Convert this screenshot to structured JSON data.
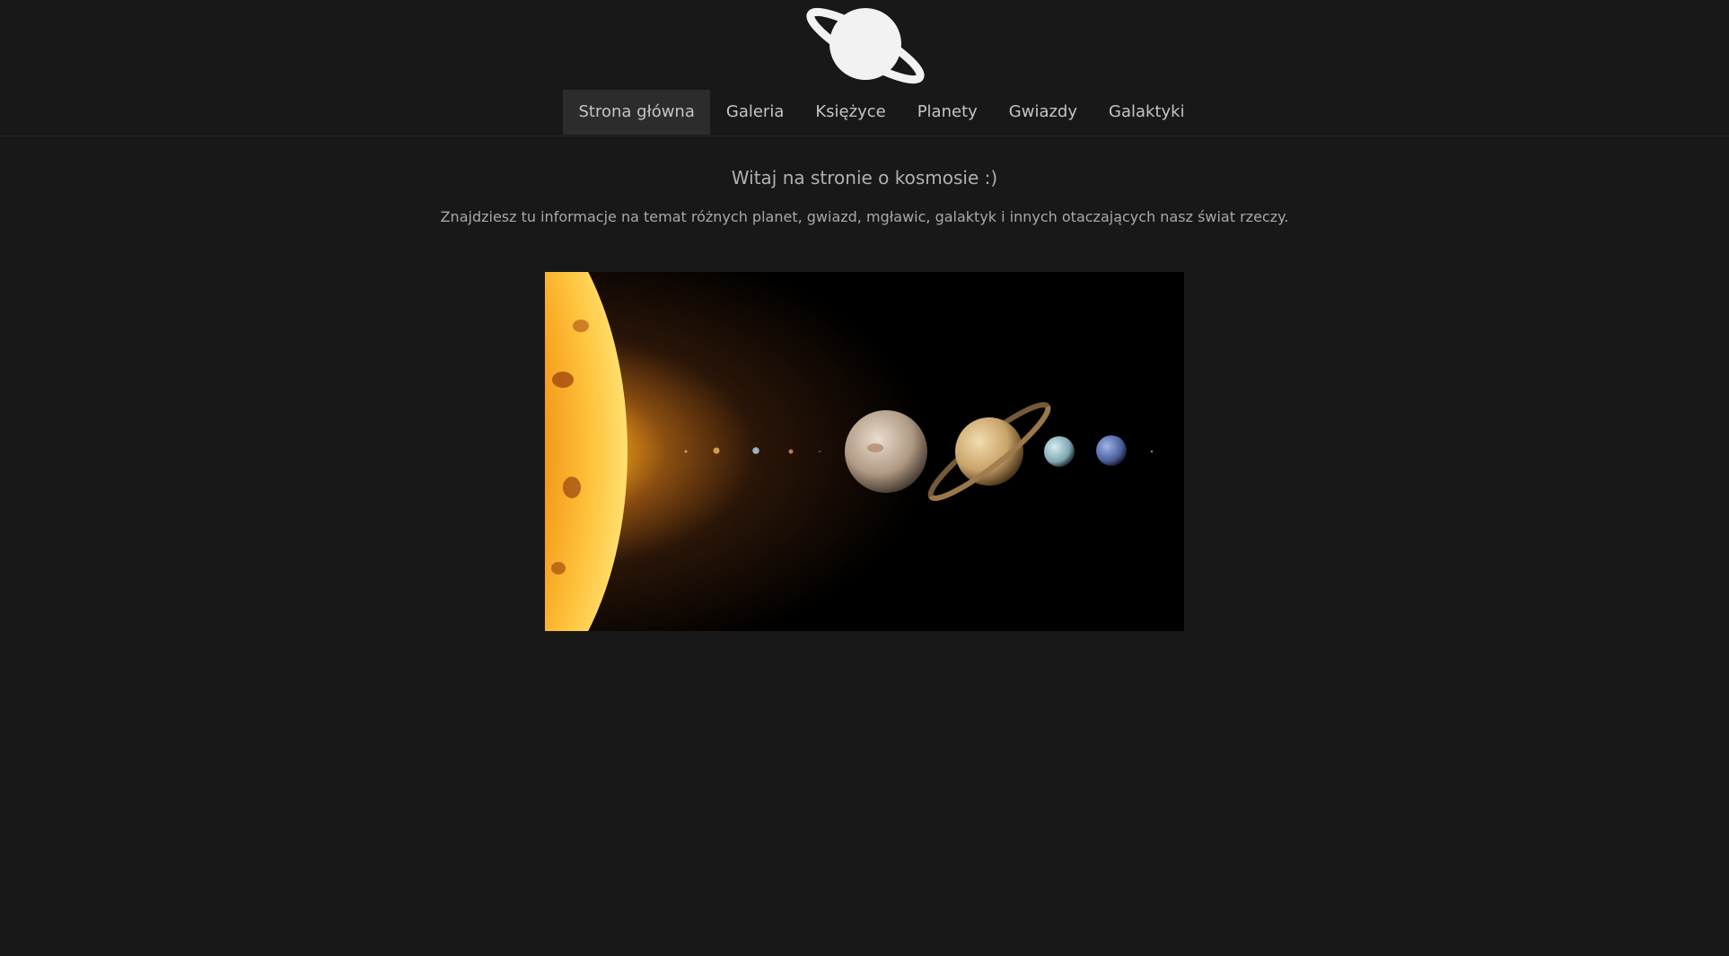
{
  "header": {
    "logo_icon": "saturn-planet-icon",
    "nav": [
      {
        "label": "Strona główna",
        "active": true
      },
      {
        "label": "Galeria",
        "active": false
      },
      {
        "label": "Księżyce",
        "active": false
      },
      {
        "label": "Planety",
        "active": false
      },
      {
        "label": "Gwiazdy",
        "active": false
      },
      {
        "label": "Galaktyki",
        "active": false
      }
    ]
  },
  "main": {
    "title": "Witaj na stronie o kosmosie :)",
    "subtitle": "Znajdziesz tu informacje na temat różnych planet, gwiazd, mgławic, galaktyk i innych otaczających nasz świat rzeczy.",
    "hero_image": "solar-system-image"
  },
  "colors": {
    "background": "#181818",
    "nav_active": "#2c2c2c",
    "text": "#c4c4c4"
  }
}
